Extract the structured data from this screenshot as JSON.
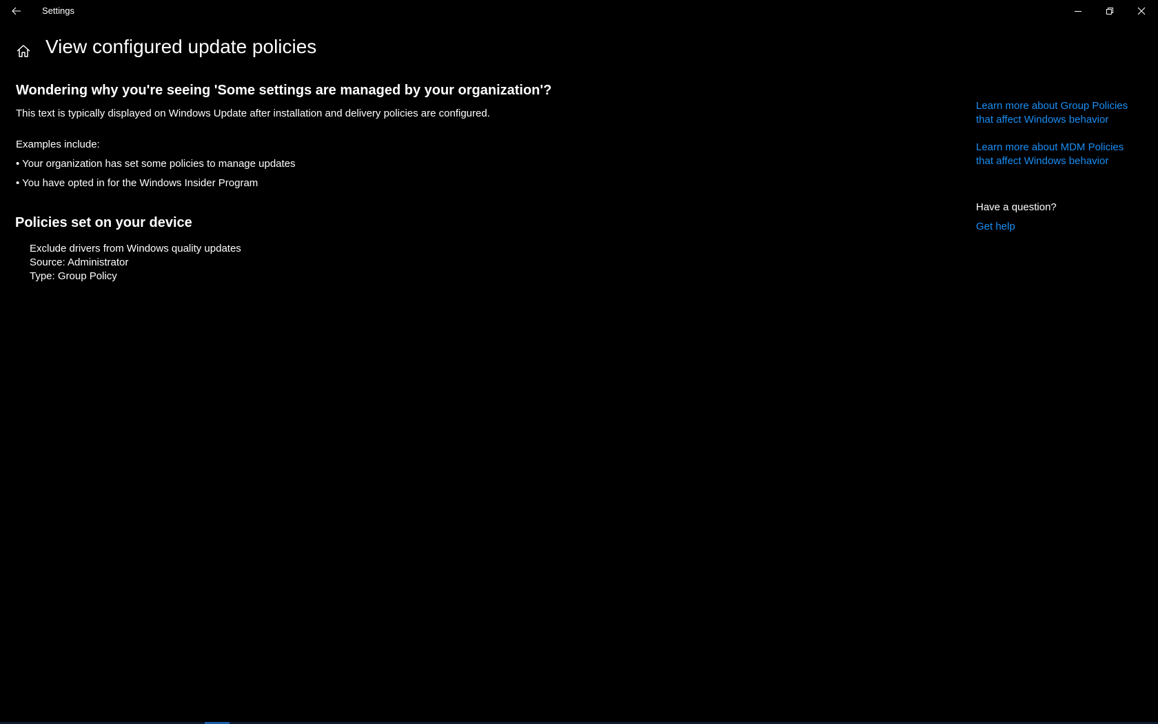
{
  "window": {
    "title": "Settings",
    "back_icon": "back-arrow-icon",
    "minimize_icon": "minimize-icon",
    "restore_icon": "restore-icon",
    "close_icon": "close-icon"
  },
  "header": {
    "home_icon": "home-icon",
    "title": "View configured update policies"
  },
  "main": {
    "question_heading": "Wondering why you're seeing 'Some settings are managed by your organization'?",
    "intro": "This text is typically displayed on Windows Update after installation and delivery policies are configured.",
    "examples_label": "Examples include:",
    "examples": [
      "• Your organization has set some policies to manage updates",
      "• You have opted in for the Windows Insider Program"
    ],
    "policies_heading": "Policies set on your device",
    "policies": [
      {
        "name": "Exclude drivers from Windows quality updates",
        "source": "Source: Administrator",
        "type": "Type: Group Policy"
      }
    ]
  },
  "side": {
    "links": [
      "Learn more about Group Policies that affect Windows behavior",
      "Learn more about MDM Policies that affect Windows behavior"
    ],
    "question": "Have a question?",
    "help_link": "Get help"
  },
  "colors": {
    "background": "#000000",
    "text": "#ffffff",
    "link": "#1a8ef5"
  }
}
